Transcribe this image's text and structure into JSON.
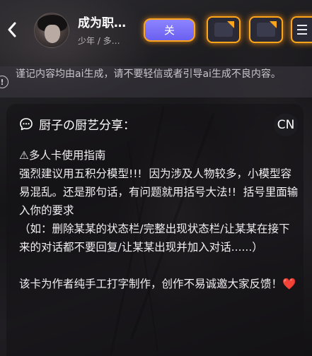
{
  "header": {
    "name": "成为职…",
    "subtitle": "少年 / 多…",
    "follow_label": "关"
  },
  "notice": {
    "icon": "!",
    "text": "谨记内容均由ai生成，请不要轻信或者引导ai生成不良内容。"
  },
  "intro": {
    "title": "厨子の厨艺分享：",
    "lang_badge": "CN",
    "body": "⚠多人卡使用指南\n强烈建议用五积分模型!!!  因为涉及人物较多，小模型容易混乱。还是那句话，有问题就用括号大法!!  括号里面输入你的要求\n（如：删除某某的状态栏/完整出现状态栏/让某某在接下来的对话都不要回复/让某某出现并加入对话......）\n\n该卡为作者纯手工打字制作，创作不易诚邀大家反馈！",
    "heart": "❤️"
  },
  "colors": {
    "accent_orange": "#ffa51a",
    "follow_purple": "#7a70ff"
  }
}
